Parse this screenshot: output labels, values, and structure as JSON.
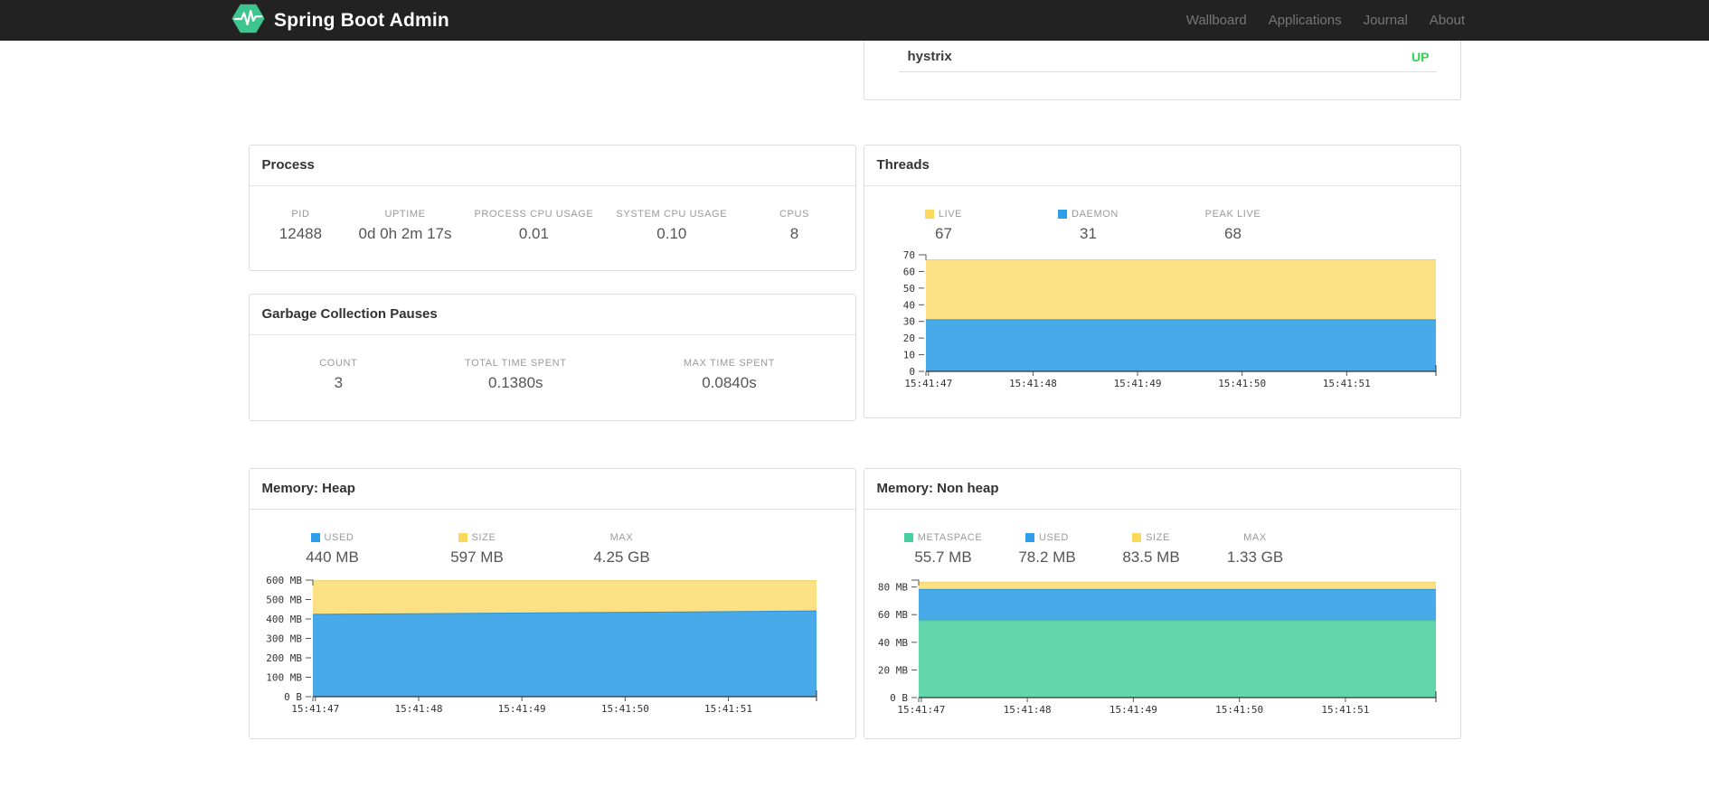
{
  "navbar": {
    "brand": "Spring Boot Admin",
    "logo_color": "#3ec48e",
    "links": [
      {
        "label": "Wallboard"
      },
      {
        "label": "Applications"
      },
      {
        "label": "Journal"
      },
      {
        "label": "About"
      }
    ]
  },
  "application_panel": {
    "name": "hystrix",
    "status": "UP",
    "status_color": "#2bd64d"
  },
  "cards": {
    "process": {
      "title": "Process",
      "stats": [
        {
          "label": "PID",
          "value": "12488"
        },
        {
          "label": "UPTIME",
          "value": "0d 0h 2m 17s"
        },
        {
          "label": "PROCESS CPU USAGE",
          "value": "0.01"
        },
        {
          "label": "SYSTEM CPU USAGE",
          "value": "0.10"
        },
        {
          "label": "CPUS",
          "value": "8"
        }
      ]
    },
    "gc": {
      "title": "Garbage Collection Pauses",
      "stats": [
        {
          "label": "COUNT",
          "value": "3"
        },
        {
          "label": "TOTAL TIME SPENT",
          "value": "0.1380s"
        },
        {
          "label": "MAX TIME SPENT",
          "value": "0.0840s"
        }
      ]
    },
    "threads": {
      "title": "Threads",
      "stats": [
        {
          "label": "LIVE",
          "value": "67",
          "swatch": "#fcd95c"
        },
        {
          "label": "DAEMON",
          "value": "31",
          "swatch": "#2d9fe8"
        },
        {
          "label": "PEAK LIVE",
          "value": "68"
        }
      ]
    },
    "heap": {
      "title": "Memory: Heap",
      "stats": [
        {
          "label": "USED",
          "value": "440 MB",
          "swatch": "#2d9fe8"
        },
        {
          "label": "SIZE",
          "value": "597 MB",
          "swatch": "#fcd95c"
        },
        {
          "label": "MAX",
          "value": "4.25 GB"
        }
      ]
    },
    "nonheap": {
      "title": "Memory: Non heap",
      "stats": [
        {
          "label": "METASPACE",
          "value": "55.7 MB",
          "swatch": "#47cf9f"
        },
        {
          "label": "USED",
          "value": "78.2 MB",
          "swatch": "#2d9fe8"
        },
        {
          "label": "SIZE",
          "value": "83.5 MB",
          "swatch": "#fcd95c"
        },
        {
          "label": "MAX",
          "value": "1.33 GB"
        }
      ]
    }
  },
  "chart_data": [
    {
      "type": "area",
      "title": "Threads",
      "legend_position": "top",
      "grid": false,
      "x_labels": [
        "15:41:47",
        "15:41:48",
        "15:41:49",
        "15:41:50",
        "15:41:51"
      ],
      "x_tick_fractions": [
        0.005,
        0.21,
        0.415,
        0.62,
        0.825
      ],
      "y_max": 70,
      "y_ticks": [
        {
          "value": 0,
          "label": "0"
        },
        {
          "value": 10,
          "label": "10"
        },
        {
          "value": 20,
          "label": "20"
        },
        {
          "value": 30,
          "label": "30"
        },
        {
          "value": 40,
          "label": "40"
        },
        {
          "value": 50,
          "label": "50"
        },
        {
          "value": 60,
          "label": "60"
        },
        {
          "value": 70,
          "label": "70"
        }
      ],
      "series": [
        {
          "name": "LIVE",
          "fill": "#fbe183",
          "stroke": "#f0d269",
          "values": [
            67,
            67,
            67,
            67,
            67,
            67
          ]
        },
        {
          "name": "DAEMON",
          "fill": "#49aae9",
          "stroke": "#2f8fd0",
          "values": [
            31,
            31,
            31,
            31,
            31,
            31
          ]
        }
      ]
    },
    {
      "type": "area",
      "title": "Memory: Heap",
      "legend_position": "top",
      "grid": false,
      "x_labels": [
        "15:41:47",
        "15:41:48",
        "15:41:49",
        "15:41:50",
        "15:41:51"
      ],
      "x_tick_fractions": [
        0.005,
        0.21,
        0.415,
        0.62,
        0.825
      ],
      "y_max": 600,
      "y_ticks": [
        {
          "value": 0,
          "label": "0 B"
        },
        {
          "value": 100,
          "label": "100 MB"
        },
        {
          "value": 200,
          "label": "200 MB"
        },
        {
          "value": 300,
          "label": "300 MB"
        },
        {
          "value": 400,
          "label": "400 MB"
        },
        {
          "value": 500,
          "label": "500 MB"
        },
        {
          "value": 600,
          "label": "600 MB"
        }
      ],
      "series": [
        {
          "name": "SIZE",
          "fill": "#fbe183",
          "stroke": "#f0d269",
          "values": [
            597,
            597,
            597,
            597,
            597,
            597
          ]
        },
        {
          "name": "USED",
          "fill": "#49aae9",
          "stroke": "#2f8fd0",
          "values": [
            424,
            427,
            430,
            434,
            437,
            441
          ]
        }
      ]
    },
    {
      "type": "area",
      "title": "Memory: Non heap",
      "legend_position": "top",
      "grid": false,
      "x_labels": [
        "15:41:47",
        "15:41:48",
        "15:41:49",
        "15:41:50",
        "15:41:51"
      ],
      "x_tick_fractions": [
        0.005,
        0.21,
        0.415,
        0.62,
        0.825
      ],
      "y_max": 85,
      "y_ticks": [
        {
          "value": 0,
          "label": "0 B"
        },
        {
          "value": 20,
          "label": "20 MB"
        },
        {
          "value": 40,
          "label": "40 MB"
        },
        {
          "value": 60,
          "label": "60 MB"
        },
        {
          "value": 80,
          "label": "80 MB"
        }
      ],
      "series": [
        {
          "name": "SIZE",
          "fill": "#fbe183",
          "stroke": "#f0d269",
          "values": [
            83.5,
            83.5,
            83.5,
            83.5,
            83.5,
            83.5
          ]
        },
        {
          "name": "USED",
          "fill": "#49aae9",
          "stroke": "#2f8fd0",
          "values": [
            78.2,
            78.2,
            78.2,
            78.2,
            78.2,
            78.2
          ]
        },
        {
          "name": "METASPACE",
          "fill": "#62d7ab",
          "stroke": "#4cc39a",
          "values": [
            55.7,
            55.7,
            55.7,
            55.7,
            55.7,
            55.7
          ]
        }
      ]
    }
  ]
}
